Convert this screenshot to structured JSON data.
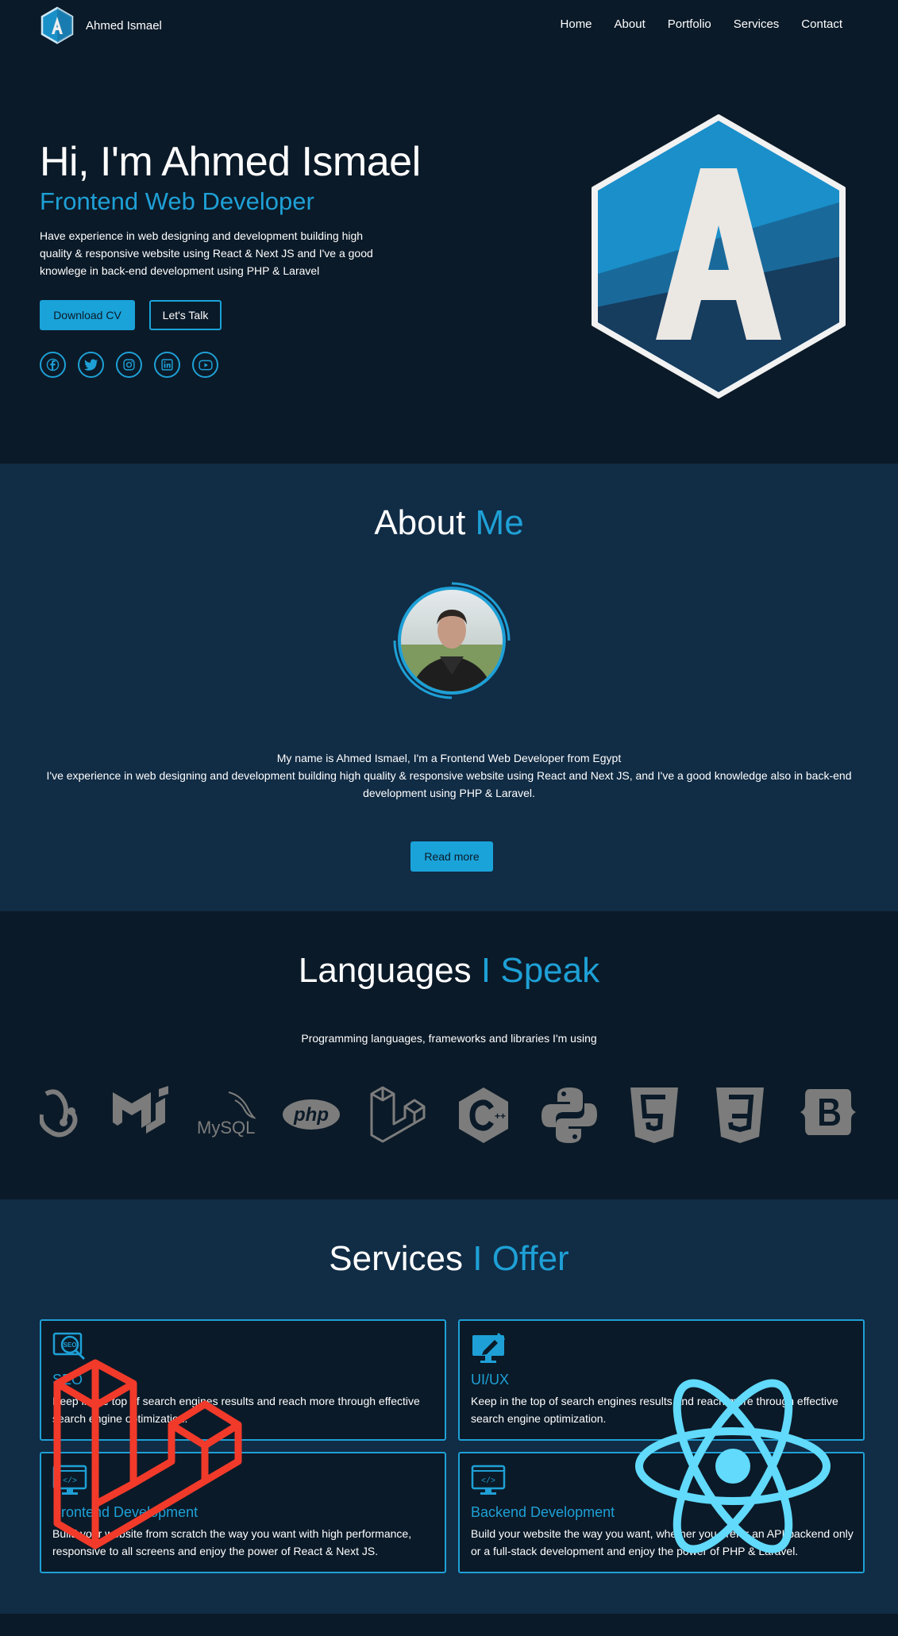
{
  "nav": {
    "brand": "Ahmed Ismael",
    "links": [
      "Home",
      "About",
      "Portfolio",
      "Services",
      "Contact"
    ]
  },
  "hero": {
    "title": "Hi, I'm Ahmed Ismael",
    "subtitle": "Frontend Web Developer",
    "description": "Have experience in web designing and development building high quality & responsive website using React & Next JS and I've a good knowlege in back-end development using PHP & Laravel",
    "download_label": "Download CV",
    "talk_label": "Let's Talk",
    "socials": [
      "facebook-icon",
      "twitter-icon",
      "instagram-icon",
      "linkedin-icon",
      "youtube-icon"
    ]
  },
  "about": {
    "title_main": "About",
    "title_accent": "Me",
    "line1": "My name is Ahmed Ismael, I'm a Frontend Web Developer from Egypt",
    "line2": "I've experience in web designing and development building high quality & responsive website using React and Next JS, and I've a good knowledge also in back-end development using PHP & Laravel.",
    "read_more": "Read more"
  },
  "languages": {
    "title_main": "Languages",
    "title_accent": "I Speak",
    "description": "Programming languages, frameworks and libraries I'm using",
    "tech_icons": [
      "redux-icon",
      "materialui-icon",
      "mysql-icon",
      "php-icon",
      "laravel-icon",
      "cplusplus-icon",
      "python-icon",
      "html5-icon",
      "css3-icon",
      "bootstrap-icon"
    ],
    "mysql_text": "MySQL",
    "php_text": "php"
  },
  "services": {
    "title_main": "Services",
    "title_accent": "I Offer",
    "cards": [
      {
        "title": "SEO",
        "desc": "Keep in the top of search engines results and reach more through effective search engine optimization.",
        "icon": "seo-icon",
        "icon_text": "SEO"
      },
      {
        "title": "UI/UX",
        "desc": "Keep in the top of search engines results and reach more through effective search engine optimization.",
        "icon": "design-icon"
      },
      {
        "title": "Frontend Development",
        "desc": "Build your website from scratch the way you want with high performance, responsive to all screens and enjoy the power of React & Next JS.",
        "icon": "code-monitor-icon"
      },
      {
        "title": "Backend Development",
        "desc": "Build your website the way you want, whether you prefer an API backend only or a full-stack development and enjoy the power of PHP & Laravel.",
        "icon": "code-monitor-icon"
      }
    ]
  },
  "colors": {
    "background": "#0b1a28",
    "section_alt": "#112c45",
    "accent": "#1ea0d6",
    "laravel_overlay": "#f23a2a",
    "react_overlay": "#61dafb"
  }
}
